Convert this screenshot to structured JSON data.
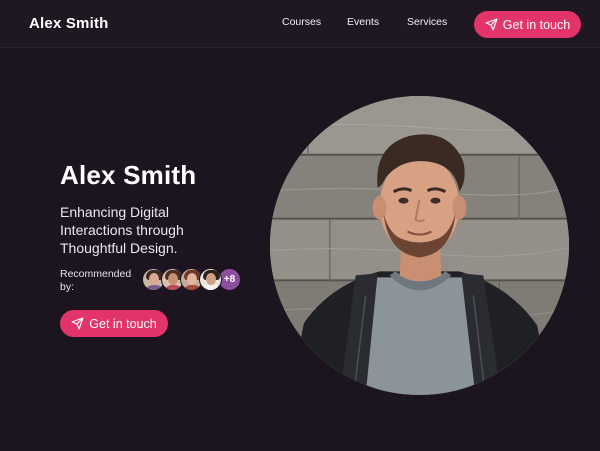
{
  "header": {
    "logo": "Alex Smith",
    "nav": [
      {
        "label": "Courses"
      },
      {
        "label": "Events"
      },
      {
        "label": "Services"
      }
    ],
    "cta_label": "Get in touch"
  },
  "hero": {
    "name": "Alex Smith",
    "tagline": "Enhancing Digital Interactions through Thoughtful Design.",
    "recommended_label": "Recommended by:",
    "recommenders_more": "+8",
    "cta_label": "Get in touch"
  },
  "colors": {
    "background": "#1c141f",
    "accent": "#e2336b",
    "more_badge": "#8c4f9e"
  },
  "icons": {
    "cta": "send-icon"
  }
}
